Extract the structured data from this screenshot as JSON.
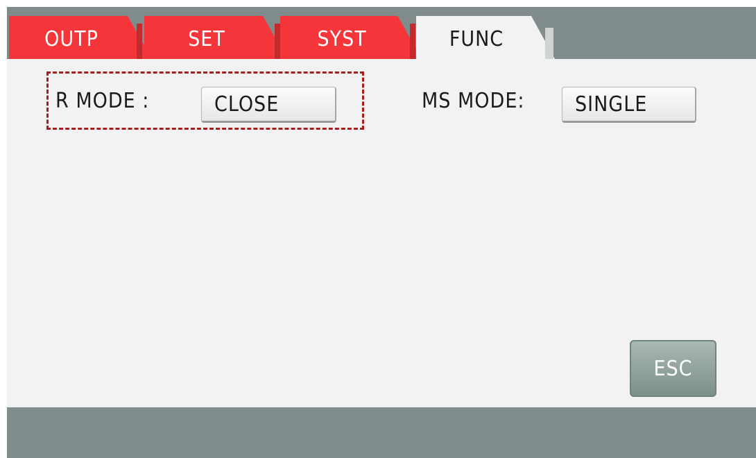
{
  "tabs": [
    {
      "label": "OUTP",
      "active": false
    },
    {
      "label": "SET",
      "active": false
    },
    {
      "label": "SYST",
      "active": false
    },
    {
      "label": "FUNC",
      "active": true
    }
  ],
  "func_panel": {
    "r_mode": {
      "label": "R MODE :",
      "value": "CLOSE"
    },
    "ms_mode": {
      "label": "MS MODE:",
      "value": "SINGLE"
    },
    "esc_label": "ESC"
  },
  "colors": {
    "tab_inactive": "#f4363a",
    "tab_active": "#f2f2f2",
    "bezel": "#7f8c8b",
    "highlight_box": "#a61d1d",
    "esc_button": "#8fa29a"
  }
}
